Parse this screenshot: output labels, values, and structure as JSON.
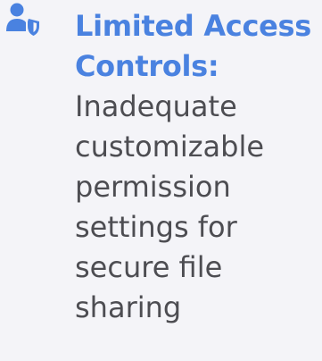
{
  "feature": {
    "icon": "user-shield-icon",
    "accent_color": "#4a82e0",
    "text_color": "#4d4d52",
    "title_line1": "Limited Access",
    "title_line2": "Controls:",
    "description_lines": [
      "Inadequate",
      "customizable",
      "permission",
      "settings for",
      "secure file",
      "sharing"
    ]
  }
}
